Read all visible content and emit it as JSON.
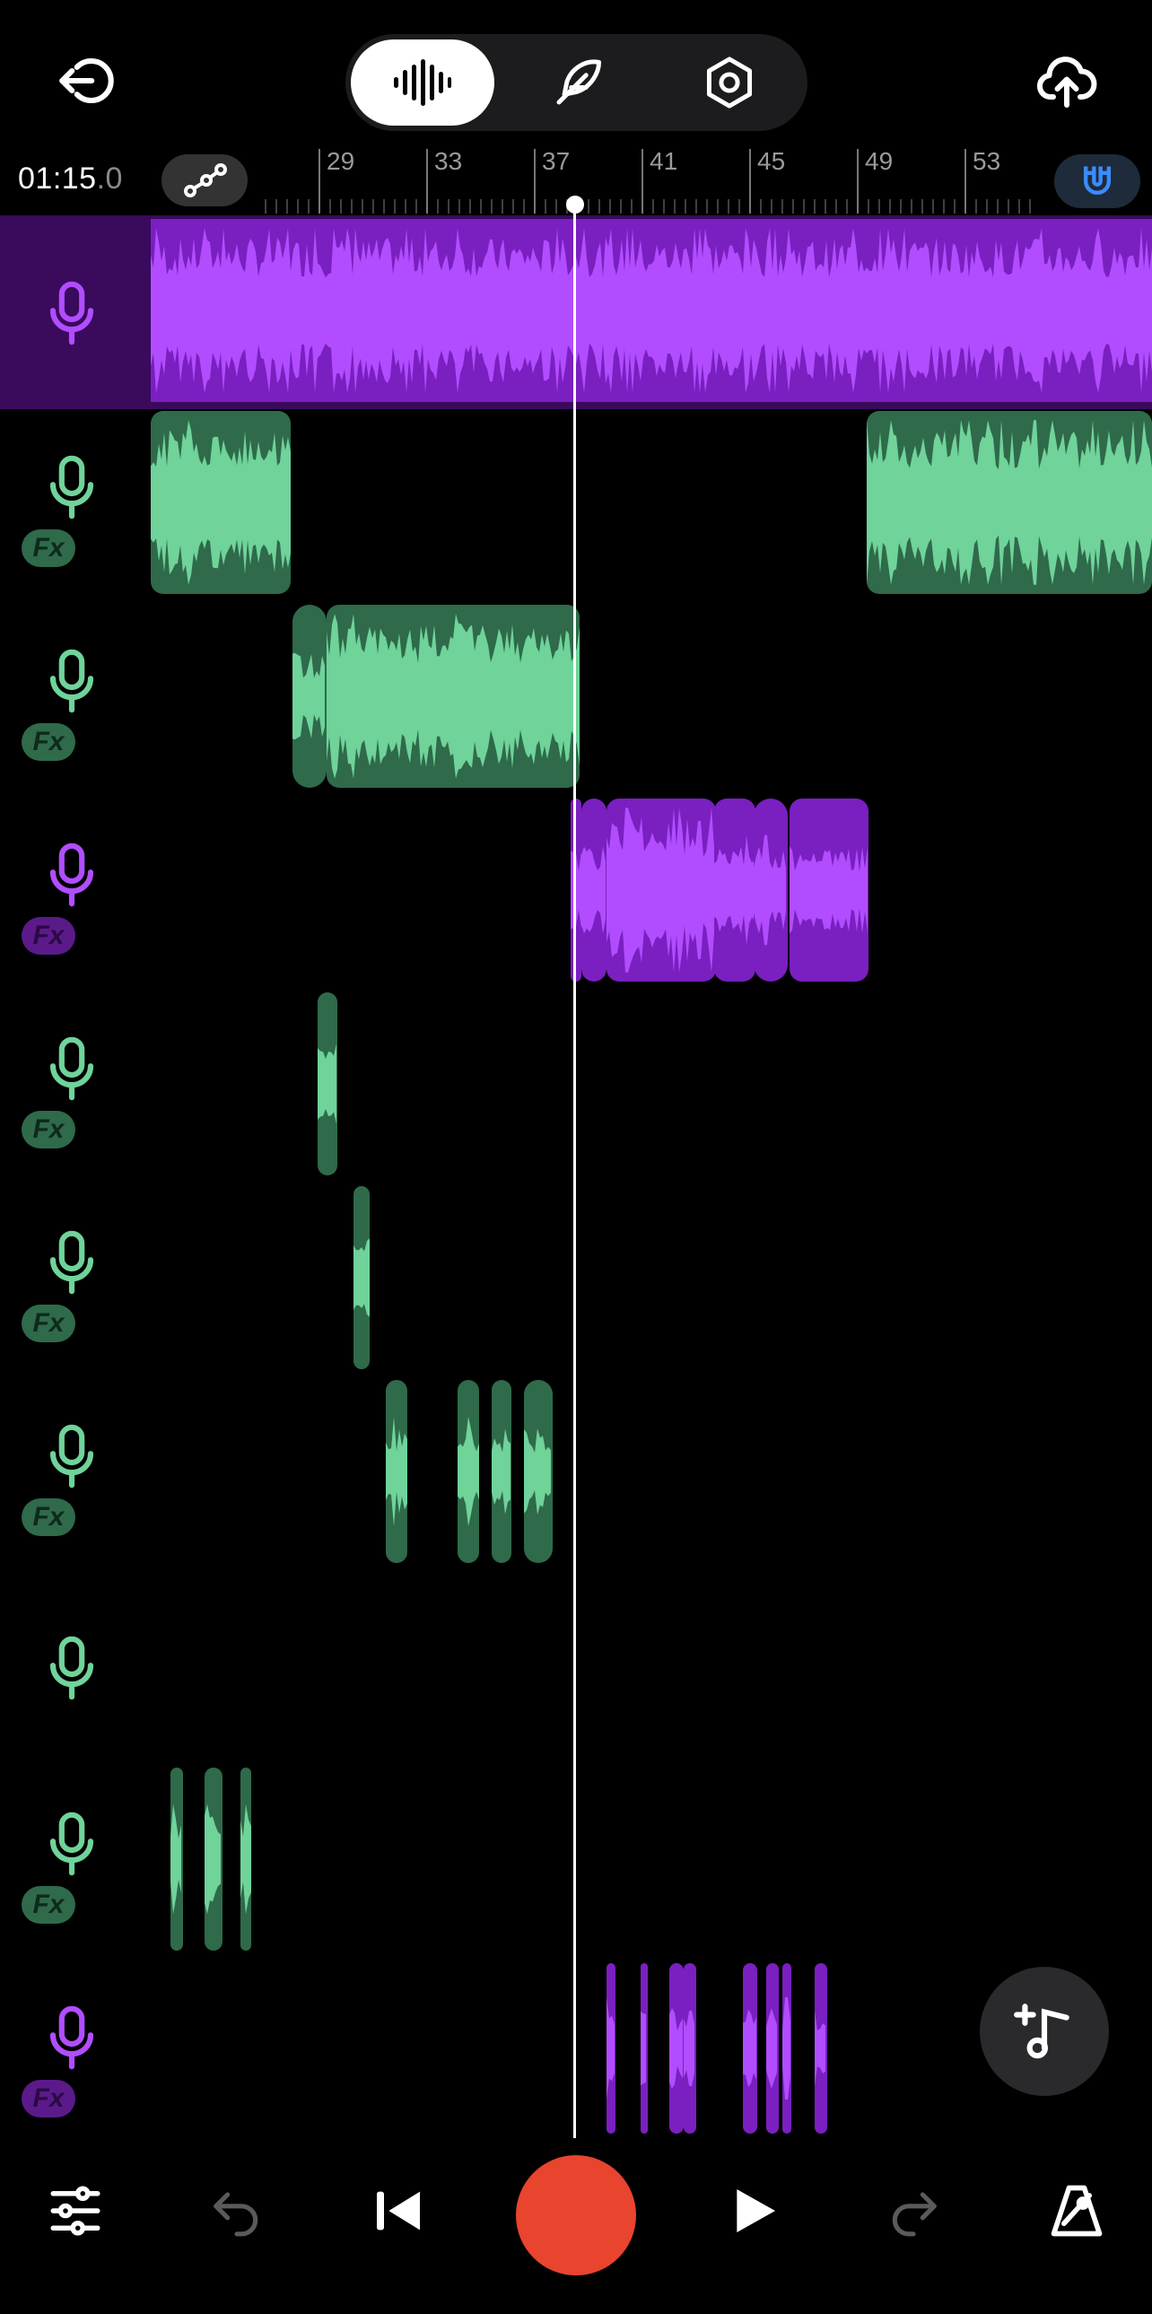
{
  "header": {
    "back_icon": "exit-icon",
    "modes": [
      {
        "name": "waveform-mode",
        "icon": "waveform-icon",
        "active": true
      },
      {
        "name": "edit-mode",
        "icon": "feather-icon",
        "active": false
      },
      {
        "name": "settings-mode",
        "icon": "hexagon-gear-icon",
        "active": false
      }
    ],
    "upload_icon": "cloud-upload-icon"
  },
  "timeline": {
    "time_main": "01:15",
    "time_frac": ".0",
    "ruler_labels": [
      "29",
      "33",
      "37",
      "41",
      "45",
      "49",
      "53"
    ],
    "automation_icon": "automation-curve-icon",
    "snap_icon": "magnet-icon"
  },
  "colors": {
    "green_clip": "#2f6a4a",
    "green_wave": "#6fd39a",
    "purple_clip": "#7a1fc0",
    "purple_wave": "#b14dff",
    "record": "#e8442e",
    "snap_active": "#3a8cff"
  },
  "tracks": [
    {
      "color": "purple",
      "fx": false,
      "selected": true
    },
    {
      "color": "green",
      "fx": true
    },
    {
      "color": "green",
      "fx": true
    },
    {
      "color": "purple",
      "fx": true
    },
    {
      "color": "green",
      "fx": true
    },
    {
      "color": "green",
      "fx": true
    },
    {
      "color": "green",
      "fx": true
    },
    {
      "color": "green",
      "fx": false
    },
    {
      "color": "green",
      "fx": true
    },
    {
      "color": "purple",
      "fx": true
    }
  ],
  "fx_label": "Fx",
  "fab_icon": "add-track-music-icon",
  "bottom": {
    "mixer_icon": "sliders-icon",
    "undo_icon": "undo-icon",
    "skip_back_icon": "skip-back-icon",
    "record_icon": "record-icon",
    "play_icon": "play-icon",
    "redo_icon": "redo-icon",
    "metronome_icon": "metronome-icon"
  }
}
